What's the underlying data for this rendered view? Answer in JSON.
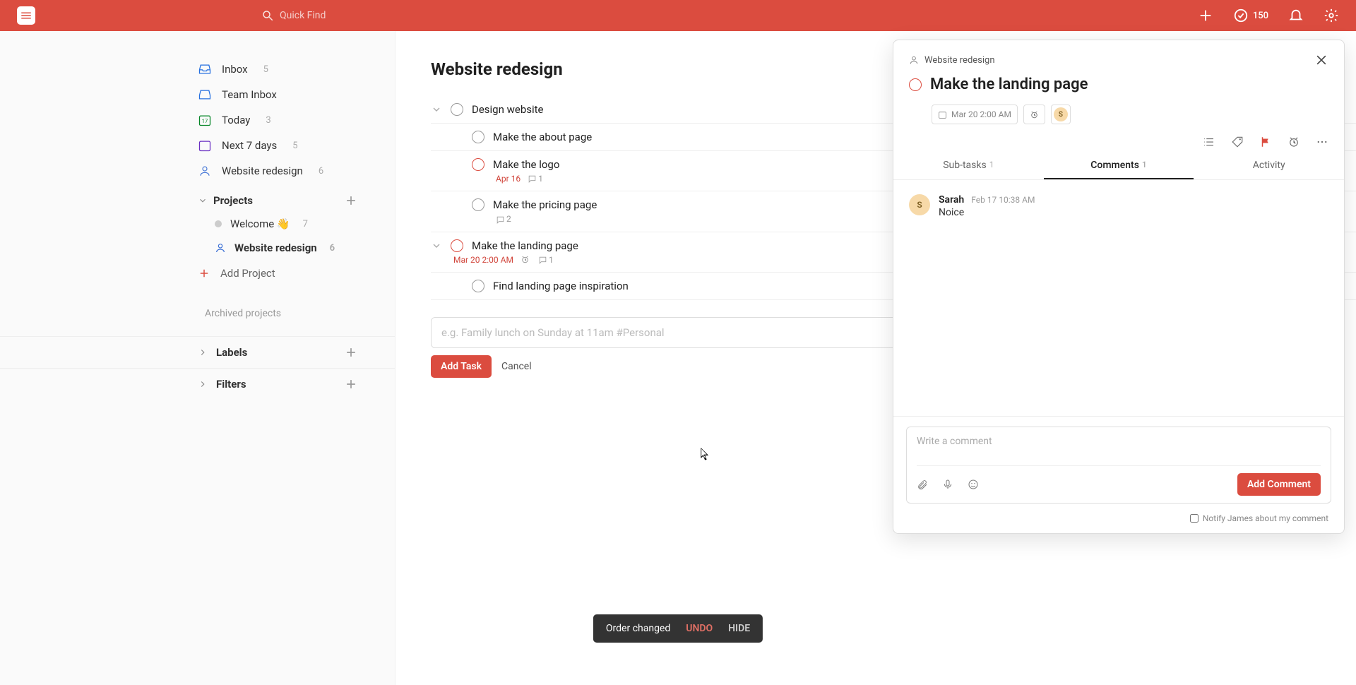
{
  "topbar": {
    "search_placeholder": "Quick Find",
    "productivity_count": "150"
  },
  "sidebar": {
    "items": [
      {
        "label": "Inbox",
        "count": "5"
      },
      {
        "label": "Team Inbox",
        "count": ""
      },
      {
        "label": "Today",
        "count": "3"
      },
      {
        "label": "Next 7 days",
        "count": "5"
      },
      {
        "label": "Website redesign",
        "count": "6"
      }
    ],
    "projects_header": "Projects",
    "projects": [
      {
        "label": "Welcome 👋",
        "count": "7",
        "active": false
      },
      {
        "label": "Website redesign",
        "count": "6",
        "active": true
      }
    ],
    "add_project_label": "Add Project",
    "archived_label": "Archived projects",
    "labels_header": "Labels",
    "filters_header": "Filters"
  },
  "main": {
    "project_title": "Website redesign",
    "tasks": [
      {
        "title": "Design website",
        "indent": 0,
        "has_children": true,
        "red": false
      },
      {
        "title": "Make the about page",
        "indent": 1,
        "has_children": false,
        "red": false
      },
      {
        "title": "Make the logo",
        "indent": 1,
        "has_children": false,
        "red": true,
        "date": "Apr 16",
        "comments": "1"
      },
      {
        "title": "Make the pricing page",
        "indent": 1,
        "has_children": false,
        "red": false,
        "comments": "2"
      },
      {
        "title": "Make the landing page",
        "indent": 0,
        "has_children": true,
        "red": true,
        "date": "Mar 20 2:00 AM",
        "reminder": true,
        "comments": "1"
      },
      {
        "title": "Find landing page inspiration",
        "indent": 1,
        "has_children": false,
        "red": false
      }
    ],
    "add_task_placeholder": "e.g. Family lunch on Sunday at 11am #Personal",
    "add_task_button": "Add Task",
    "cancel_button": "Cancel"
  },
  "detail": {
    "breadcrumb": "Website redesign",
    "title": "Make the landing page",
    "due": "Mar 20 2:00 AM",
    "assignee_initial": "S",
    "tabs": {
      "subtasks_label": "Sub-tasks",
      "subtasks_count": "1",
      "comments_label": "Comments",
      "comments_count": "1",
      "activity_label": "Activity"
    },
    "comments": [
      {
        "author": "Sarah",
        "initial": "S",
        "time": "Feb 17 10:38 AM",
        "text": "Noice"
      }
    ],
    "comment_placeholder": "Write a comment",
    "add_comment_button": "Add Comment",
    "notify_label": "Notify James about my comment"
  },
  "toast": {
    "message": "Order changed",
    "undo": "UNDO",
    "hide": "HIDE"
  }
}
